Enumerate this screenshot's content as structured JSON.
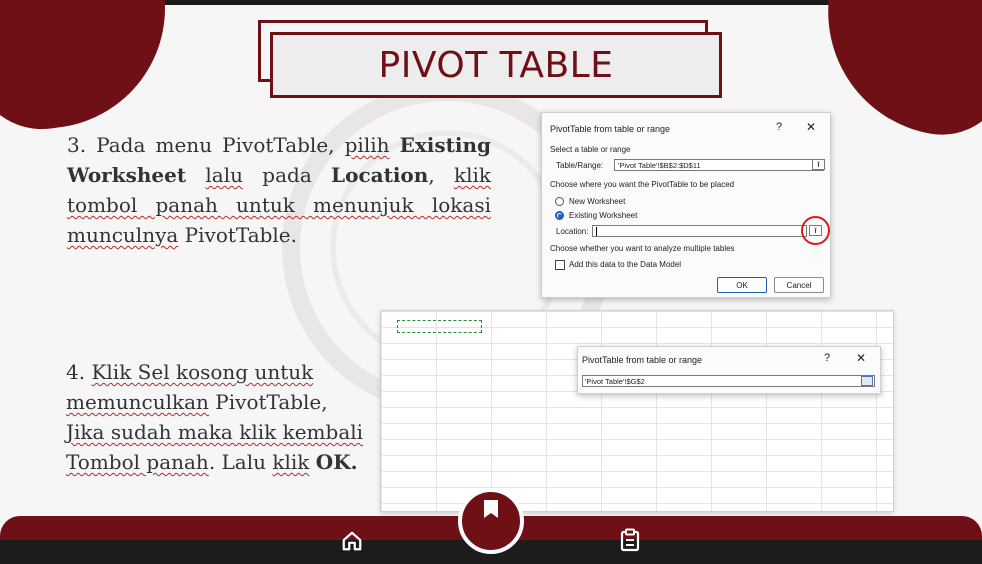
{
  "title": "PIVOT TABLE",
  "step3": {
    "t1": "3. Pada menu PivotTable, ",
    "t2": "pilih",
    "t3": " ",
    "b1": "Existing Worksheet",
    "t4": " ",
    "t5": "lalu",
    "t6": " pada ",
    "b2": "Location",
    "t7": ", ",
    "t8": "klik tombol panah untuk menunjuk lokasi munculnya",
    "t9": " PivotTable."
  },
  "step4": {
    "t1": "4. ",
    "t2": "Klik Sel kosong untuk memunculkan",
    "t3": " PivotTable, ",
    "t4": "Jika sudah maka klik kembali Tombol panah",
    "t5": ". Lalu ",
    "t6": "klik",
    "t7": " ",
    "b1": "OK."
  },
  "dialog1": {
    "title": "PivotTable from table or range",
    "help": "?",
    "close": "✕",
    "section1": "Select a table or range",
    "range_label": "Table/Range:",
    "range_value": "'Pivot Table'!$B$2:$D$11",
    "section2": "Choose where you want the PivotTable to be placed",
    "opt_new": "New Worksheet",
    "opt_existing": "Existing Worksheet",
    "location_label": "Location:",
    "location_value": "",
    "section3": "Choose whether you want to analyze multiple tables",
    "add_data_model": "Add this data to the Data Model",
    "ok": "OK",
    "cancel": "Cancel",
    "arrow_glyph": "⭱"
  },
  "dialog2": {
    "title": "PivotTable from table or range",
    "help": "?",
    "close": "✕",
    "value": "'Pivot Table'!$G$2"
  },
  "nav": {
    "home_icon": "home-icon",
    "bookmark_icon": "bookmark-icon",
    "clipboard_icon": "clipboard-icon"
  },
  "colors": {
    "brand": "#6e1016",
    "highlight": "#e01818"
  }
}
